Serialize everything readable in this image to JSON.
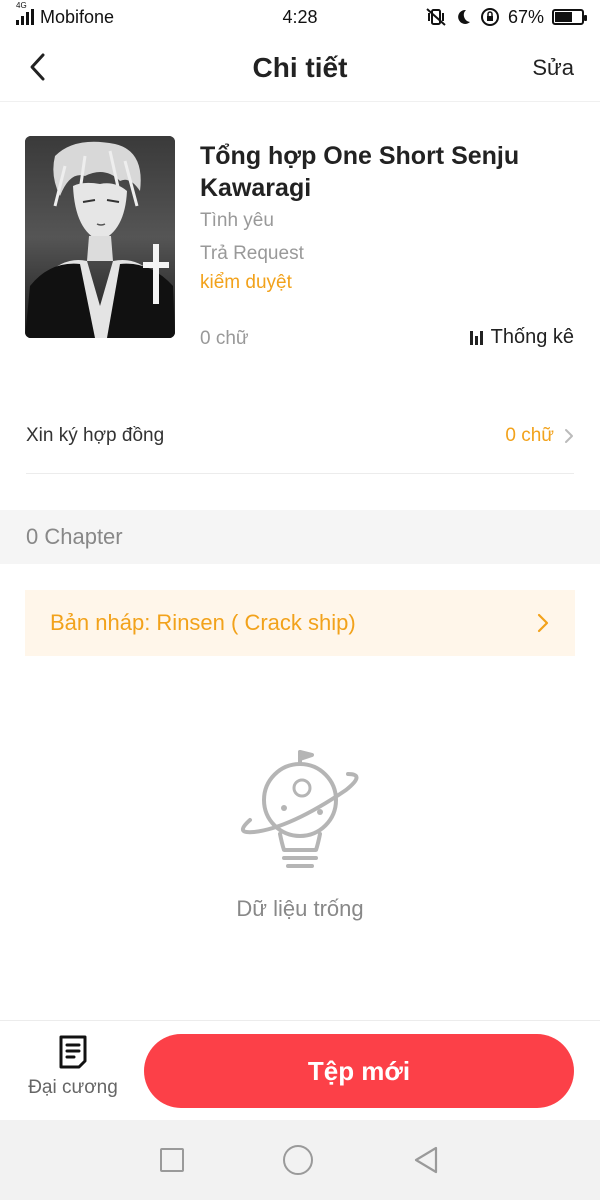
{
  "status_bar": {
    "network_type": "4G",
    "carrier": "Mobifone",
    "time": "4:28",
    "battery_percent": "67%",
    "battery_level": 0.67
  },
  "header": {
    "title": "Chi tiết",
    "edit_label": "Sửa",
    "back_icon": "chevron-left-icon"
  },
  "book": {
    "title": "Tổng hợp One Short Senju Kawaragi",
    "genre": "Tình yêu",
    "tag": "Trả Request",
    "review_status": "kiểm duyệt",
    "word_count": "0 chữ",
    "stats_label": "Thống kê"
  },
  "contract": {
    "label": "Xin ký hợp đồng",
    "value": "0 chữ"
  },
  "chapters": {
    "count_label": "0 Chapter"
  },
  "draft": {
    "label": "Bản nháp: Rinsen ( Crack ship)"
  },
  "empty_state": {
    "text": "Dữ liệu trống",
    "icon": "planet-bulb-icon"
  },
  "bottom_bar": {
    "outline_label": "Đại cương",
    "new_file_label": "Tệp mới"
  },
  "colors": {
    "accent_orange": "#f2a21b",
    "primary_red": "#fc4048",
    "draft_bg": "#fff6ea"
  }
}
